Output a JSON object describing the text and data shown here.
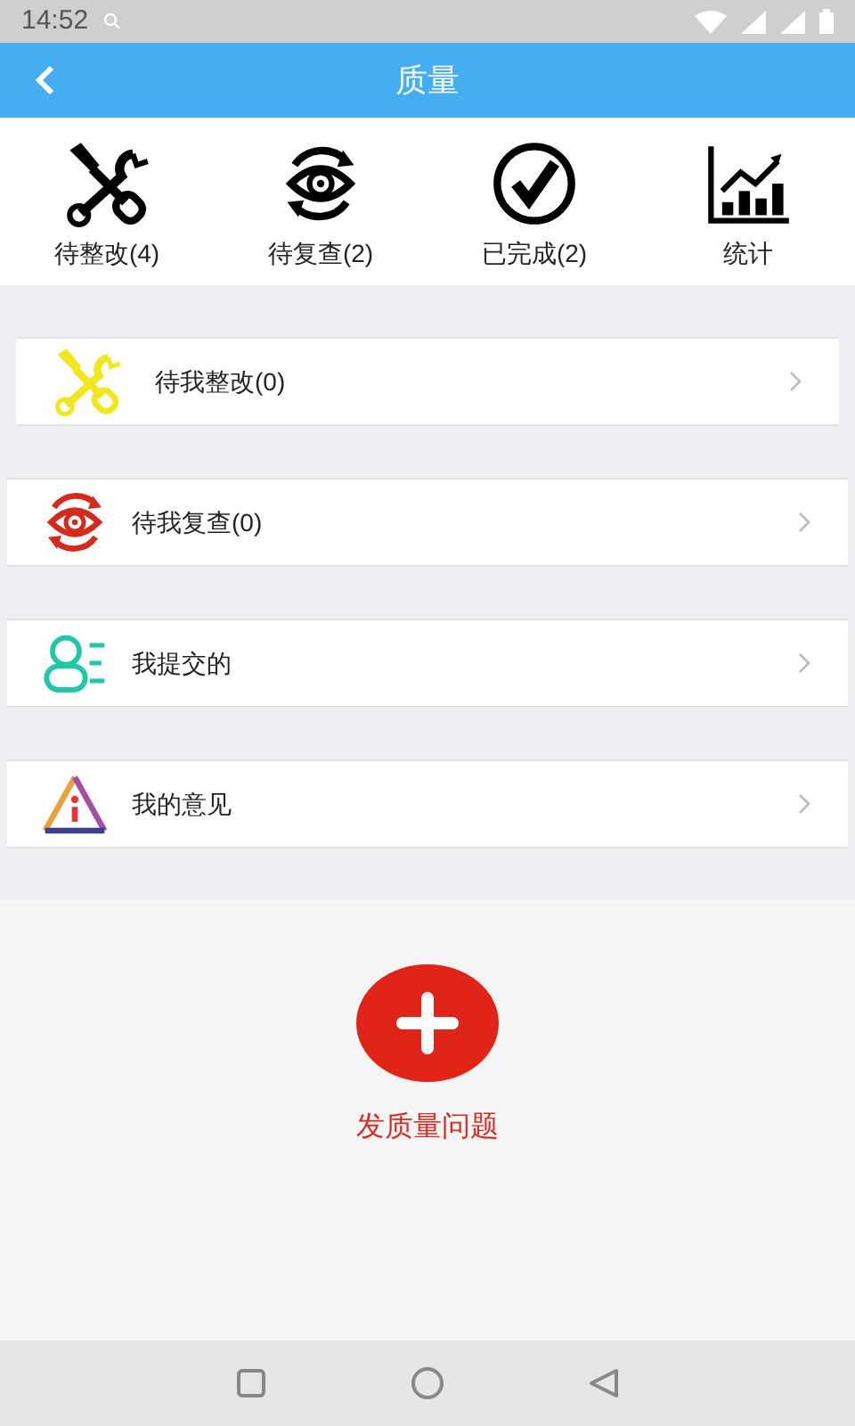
{
  "status_bar": {
    "time": "14:52"
  },
  "header": {
    "title": "质量"
  },
  "shortcuts": [
    {
      "kind": "tools",
      "label": "待整改(4)"
    },
    {
      "kind": "eye",
      "label": "待复查(2)"
    },
    {
      "kind": "check",
      "label": "已完成(2)"
    },
    {
      "kind": "chart",
      "label": "统计"
    }
  ],
  "menu": [
    {
      "kind": "tools",
      "label": "待我整改(0)"
    },
    {
      "kind": "eye",
      "label": "待我复查(0)"
    },
    {
      "kind": "person",
      "label": "我提交的"
    },
    {
      "kind": "warning",
      "label": "我的意见"
    }
  ],
  "action": {
    "label": "发质量问题"
  }
}
